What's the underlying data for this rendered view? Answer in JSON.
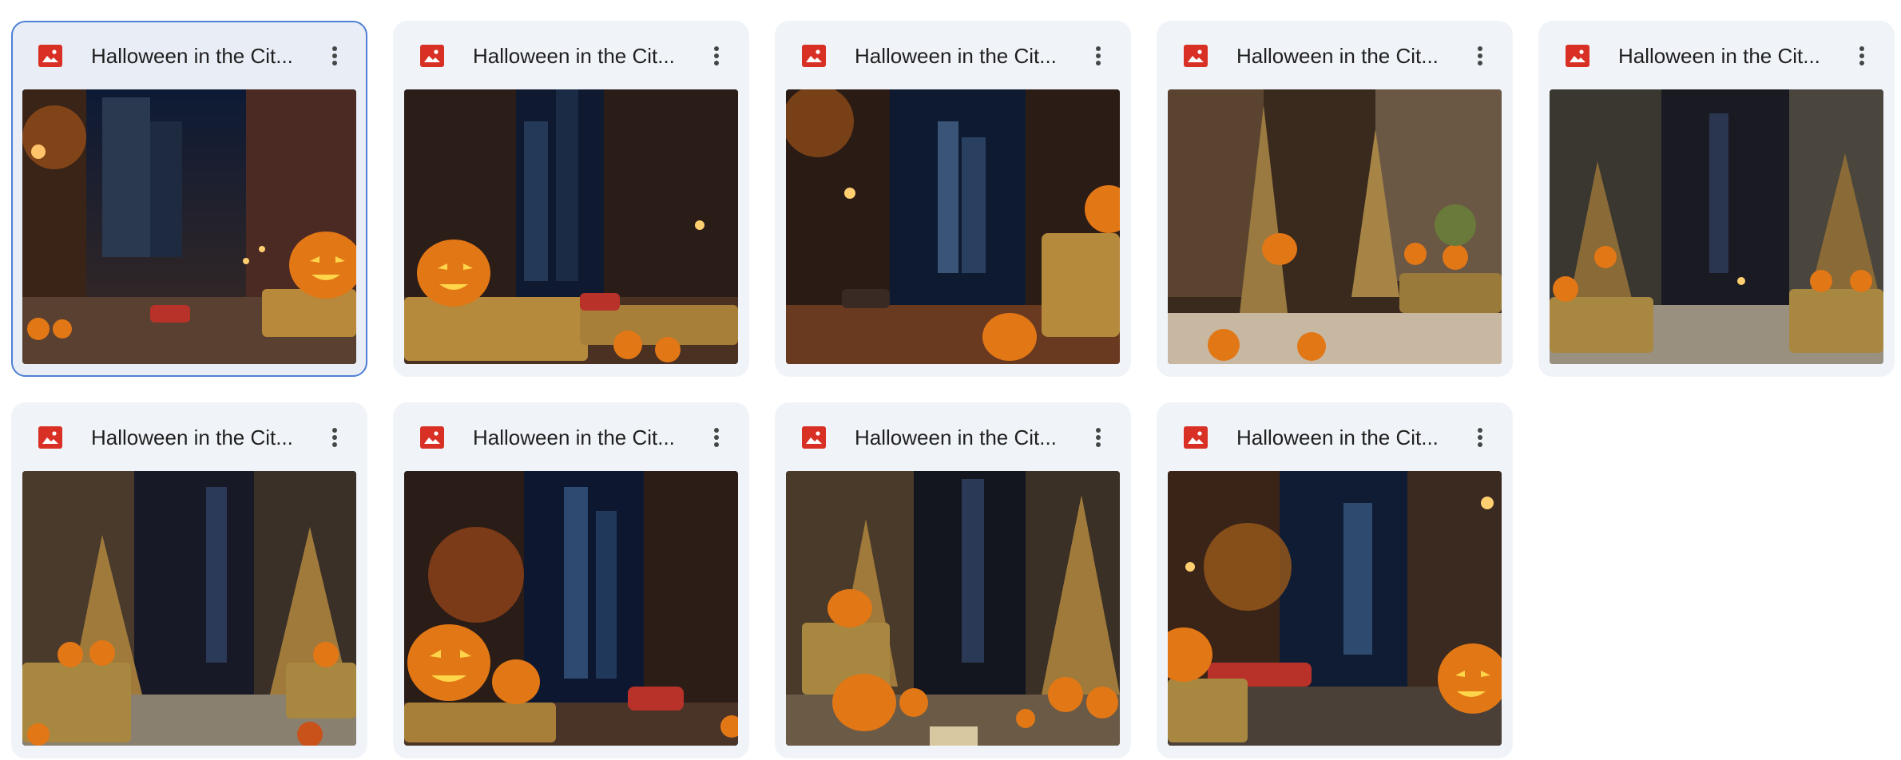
{
  "grid": {
    "files": [
      {
        "title": "Halloween in the Cit...",
        "type_icon": "image-icon",
        "selected": true
      },
      {
        "title": "Halloween in the Cit...",
        "type_icon": "image-icon",
        "selected": false
      },
      {
        "title": "Halloween in the Cit...",
        "type_icon": "image-icon",
        "selected": false
      },
      {
        "title": "Halloween in the Cit...",
        "type_icon": "image-icon",
        "selected": false
      },
      {
        "title": "Halloween in the Cit...",
        "type_icon": "image-icon",
        "selected": false
      },
      {
        "title": "Halloween in the Cit...",
        "type_icon": "image-icon",
        "selected": false
      },
      {
        "title": "Halloween in the Cit...",
        "type_icon": "image-icon",
        "selected": false
      },
      {
        "title": "Halloween in the Cit...",
        "type_icon": "image-icon",
        "selected": false
      },
      {
        "title": "Halloween in the Cit...",
        "type_icon": "image-icon",
        "selected": false
      }
    ]
  },
  "colors": {
    "image_icon": "#d93025",
    "selection_border": "#4f7fd6",
    "card_background": "#f0f4f9"
  }
}
